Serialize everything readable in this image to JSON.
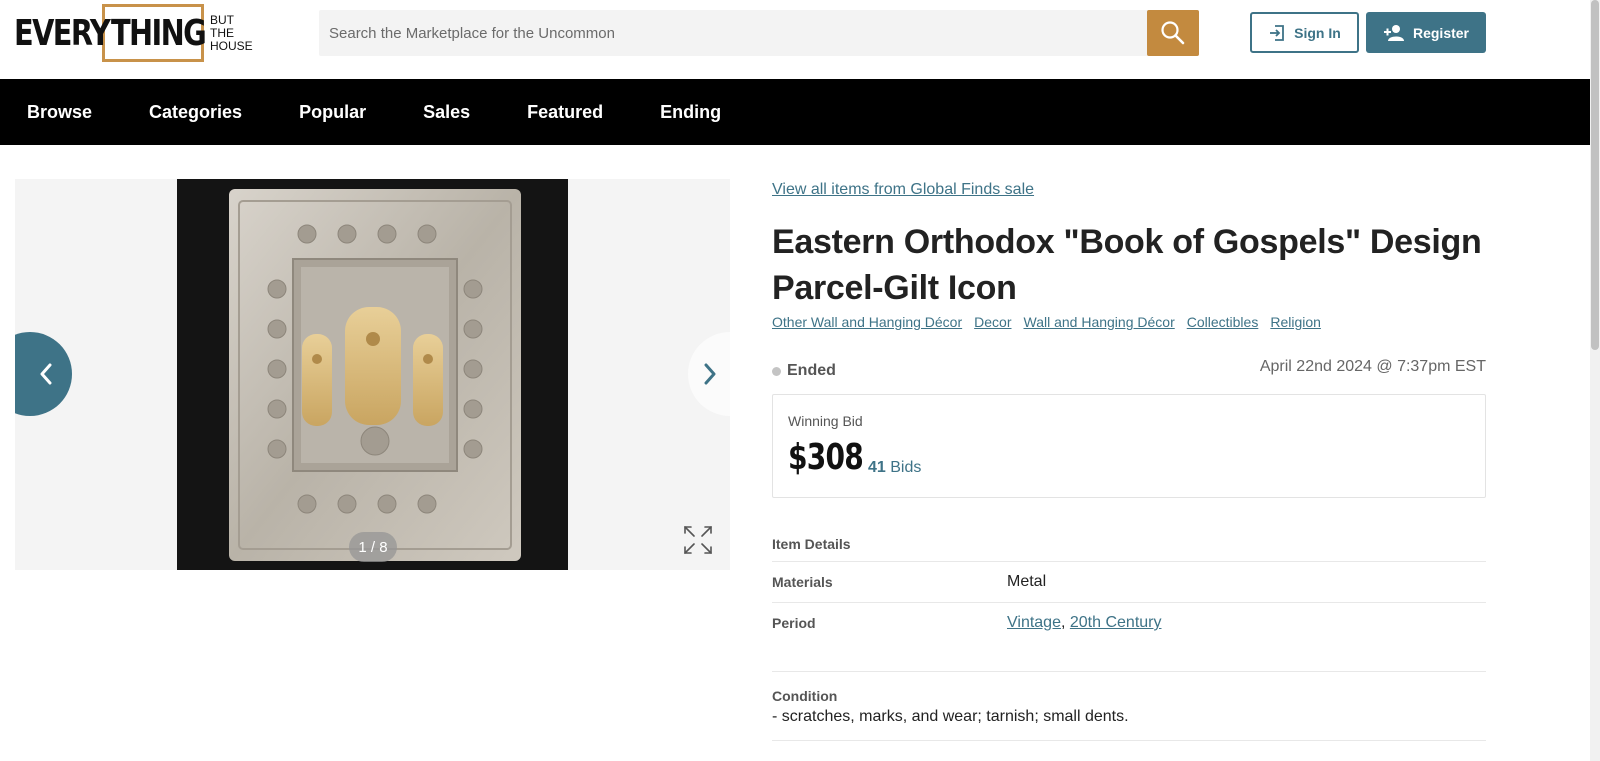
{
  "header": {
    "logo": {
      "every": "EVERY",
      "thing": "THING",
      "but": "BUT",
      "the": "THE",
      "house": "HOUSE"
    },
    "search_placeholder": "Search the Marketplace for the Uncommon",
    "signin_label": "Sign In",
    "register_label": "Register"
  },
  "nav": {
    "items": [
      "Browse",
      "Categories",
      "Popular",
      "Sales",
      "Featured",
      "Ending"
    ]
  },
  "gallery": {
    "counter": "1 / 8"
  },
  "listing": {
    "sale_link": "View all items from Global Finds sale",
    "title": "Eastern Orthodox \"Book of Gospels\" Design Parcel-Gilt Icon",
    "categories": [
      "Other Wall and Hanging Décor",
      "Decor",
      "Wall and Hanging Décor",
      "Collectibles",
      "Religion"
    ],
    "status": "Ended",
    "end_date": "April 22nd 2024 @ 7:37pm EST",
    "bid_label": "Winning Bid",
    "bid_amount": "$308",
    "bid_count": "41",
    "bid_count_label": "Bids",
    "details_title": "Item Details",
    "details": [
      {
        "key": "Materials",
        "value": "Metal"
      },
      {
        "key": "Period",
        "values": [
          "Vintage",
          "20th Century"
        ]
      }
    ],
    "condition_label": "Condition",
    "condition_value": "- scratches, marks, and wear; tarnish; small dents."
  },
  "colors": {
    "accent": "#3e7387",
    "gold": "#c38a3f",
    "nav_bg": "#000000"
  }
}
